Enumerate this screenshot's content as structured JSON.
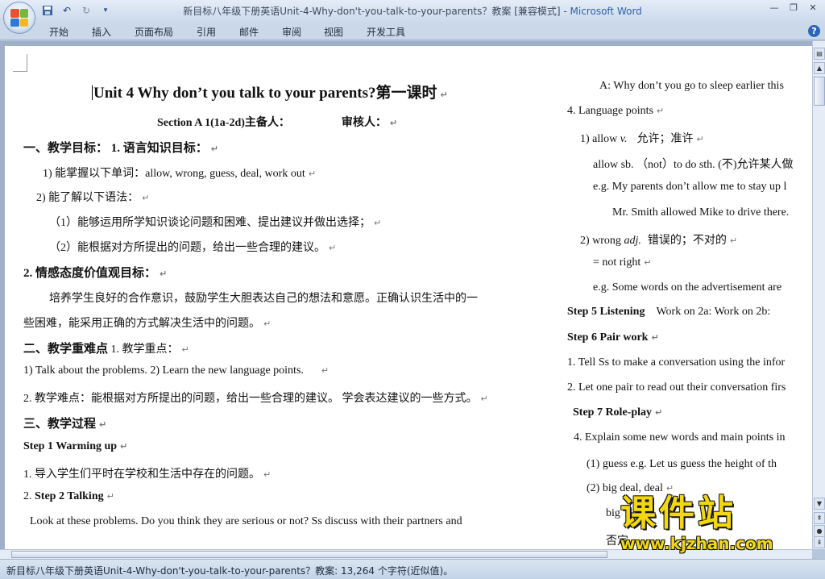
{
  "window": {
    "title_doc": "新目标八年级下册英语Unit-4-Why-don't-you-talk-to-your-parents？教案 [兼容模式] - ",
    "title_app": "Microsoft Word"
  },
  "ribbon": {
    "tabs": [
      "开始",
      "插入",
      "页面布局",
      "引用",
      "邮件",
      "审阅",
      "视图",
      "开发工具"
    ]
  },
  "doc": {
    "heading": "Unit 4 Why don’t you talk to your parents?第一课时",
    "section": "Section A 1(1a-2d)主备人：",
    "reviewer": "审核人：",
    "left": [
      "一、教学目标：  1. 语言知识目标：",
      "1) 能掌握以下单词：allow, wrong, guess, deal, work out",
      "2) 能了解以下语法：",
      "（1）能够运用所学知识谈论问题和困难、提出建议并做出选择；",
      "（2）能根据对方所提出的问题，给出一些合理的建议。",
      "2. 情感态度价值观目标：",
      "培养学生良好的合作意识，鼓励学生大胆表达自己的想法和意愿。正确认识生活中的一",
      "些困难，能采用正确的方式解决生活中的问题。",
      "二、教学重难点",
      "1. 教学重点：",
      "1) Talk about the problems.  2) Learn the new language points.",
      "2. 教学难点：能根据对方所提出的问题，给出一些合理的建议。 学会表达建议的一些方式。",
      "三、教学过程",
      "Step 1 Warming up",
      "1.   导入学生们平时在学校和生活中存在的问题。",
      "2.   ",
      "Step 2 Talking",
      "Look at these problems. Do you think they are serious or not? Ss discuss with their partners and"
    ],
    "right": [
      "A: Why don’t you go to sleep earlier this",
      "4. Language points",
      "1) allow ",
      "v.",
      "允许；准许",
      "allow sb. （not）to do sth. (不)允许某人做",
      "e.g. My parents don’t allow me to stay up l",
      "Mr. Smith allowed Mike to drive there.",
      "2) wrong ",
      "adj.",
      "错误的；不对的",
      "= not right",
      "e.g. Some words on the advertisement are",
      "Step 5 Listening",
      "Work on 2a:    Work on 2b:",
      "Step 6 Pair work",
      "1. Tell Ss to make a conversation using the infor",
      "2. Let one pair to read out their conversation firs",
      "Step 7 Role-play",
      "4. Explain some new words and main points in",
      "(1) guess    e.g. Let us guess the height of th",
      "(2) big deal, deal",
      "big",
      "否定"
    ]
  },
  "status": {
    "text": "新目标八年级下册英语Unit-4-Why-don't-you-talk-to-your-parents？教案: 13,264 个字符(近似值)。"
  },
  "watermark": {
    "cn": "课件站",
    "url": "www.kjzhan.com"
  },
  "colors": {
    "accent": "#2f5fa6",
    "watermark": "#f3d810"
  }
}
